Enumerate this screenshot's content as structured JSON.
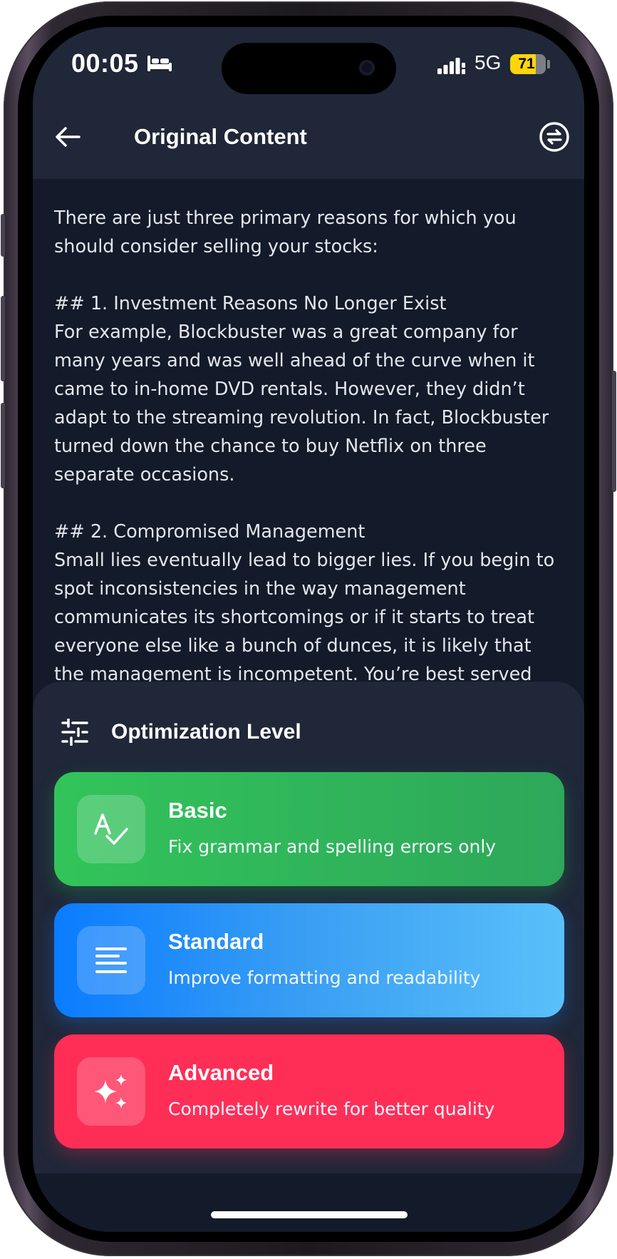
{
  "status_bar": {
    "time": "00:05",
    "network": "5G",
    "battery": "71",
    "battery_level_percent": 71
  },
  "header": {
    "title": "Original Content",
    "back_icon": "arrow-left-icon",
    "swap_icon": "swap-circle-icon"
  },
  "content": {
    "text": "There are just three primary reasons for which you should consider selling your stocks:\n\n## 1. Investment Reasons No Longer Exist\nFor example, Blockbuster was a great company for many years and was well ahead of the curve when it came to in-home DVD rentals. However, they didn’t adapt to the streaming revolution. In fact, Blockbuster turned down the chance to buy Netflix on three separate occasions.\n\n## 2. Compromised Management\nSmall lies eventually lead to bigger lies. If you begin to spot inconsistencies in the way management communicates its shortcomings or if it starts to treat everyone else like a bunch of dunces, it is likely that the management is incompetent. You’re best served"
  },
  "sheet": {
    "title": "Optimization Level",
    "icon": "sliders-icon",
    "options": [
      {
        "title": "Basic",
        "description": "Fix grammar and spelling errors only",
        "icon": "spellcheck-icon",
        "color": "#32c45a"
      },
      {
        "title": "Standard",
        "description": "Improve formatting and readability",
        "icon": "text-lines-icon",
        "color": "#0a7cff"
      },
      {
        "title": "Advanced",
        "description": "Completely rewrite for better quality",
        "icon": "sparkles-icon",
        "color": "#ff2e57"
      }
    ]
  }
}
